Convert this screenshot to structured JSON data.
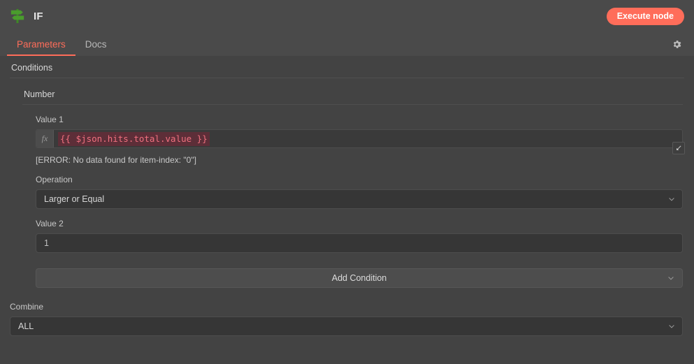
{
  "header": {
    "node_icon": "map-signs-icon",
    "node_icon_color": "#4a9c2d",
    "title": "IF",
    "execute_label": "Execute node",
    "execute_color": "#ff6d5a"
  },
  "tabs": [
    {
      "label": "Parameters",
      "active": true
    },
    {
      "label": "Docs",
      "active": false
    }
  ],
  "settings_icon": "gear-icon",
  "parameters": {
    "conditions_label": "Conditions",
    "condition_type_label": "Number",
    "value1": {
      "label": "Value 1",
      "fx_badge": "fx",
      "expression": "{{ $json.hits.total.value }}",
      "error": "[ERROR: No data found for item-index: \"0\"]",
      "expand_icon": "expand-icon"
    },
    "operation": {
      "label": "Operation",
      "value": "Larger or Equal",
      "chevron_icon": "chevron-down-icon"
    },
    "value2": {
      "label": "Value 2",
      "value": "1"
    },
    "add_condition": {
      "label": "Add Condition",
      "chevron_icon": "chevron-down-icon"
    },
    "combine": {
      "label": "Combine",
      "value": "ALL",
      "chevron_icon": "chevron-down-icon"
    }
  }
}
